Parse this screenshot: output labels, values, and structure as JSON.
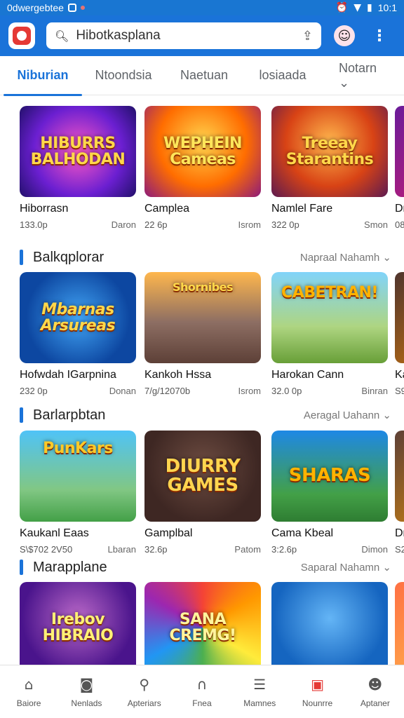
{
  "status": {
    "left_text": "0dwergebtee",
    "time": "10:1"
  },
  "search": {
    "text": "Hibotkasplana"
  },
  "icons": {
    "search": "search-icon",
    "share": "share-icon",
    "avatar": "avatar-icon",
    "menu": "more-vert-icon"
  },
  "tabs": [
    {
      "label": "Niburian",
      "active": true
    },
    {
      "label": "Ntoondsia"
    },
    {
      "label": "Naetuan"
    },
    {
      "label": "losiaada"
    },
    {
      "label": "Notarn ⌄"
    }
  ],
  "sections": [
    {
      "title": "",
      "more": "",
      "items": [
        {
          "title": "Hiborrasn",
          "meta_left": "133.0p",
          "meta_right": "Daron",
          "art": "HIBURRS BALHODAN"
        },
        {
          "title": "Camplea",
          "meta_left": "22 6p",
          "meta_right": "Isrom",
          "art": "WEPHEIN Cameas"
        },
        {
          "title": "Namlel Fare",
          "meta_left": "322 0p",
          "meta_right": "Smon",
          "art": "Treeay Starantins"
        },
        {
          "title": "Dr",
          "meta_left": "08",
          "meta_right": "",
          "art": ""
        }
      ]
    },
    {
      "title": "Balkqplorar",
      "more": "Napraal Nahamh ⌄",
      "items": [
        {
          "title": "Hofwdah IGarpnina",
          "meta_left": "232 0p",
          "meta_right": "Donan",
          "art": "Mbarnas Arsureas"
        },
        {
          "title": "Kankoh Hssa",
          "meta_left": "7/g/12070b",
          "meta_right": "Isrom",
          "art": "Shornibes"
        },
        {
          "title": "Harokan Cann",
          "meta_left": "32.0 0p",
          "meta_right": "Binran",
          "art": "CABETRAN!"
        },
        {
          "title": "Ka",
          "meta_left": "S9",
          "meta_right": "",
          "art": ""
        }
      ]
    },
    {
      "title": "Barlarpbtan",
      "more": "Aeragal Uahann ⌄",
      "items": [
        {
          "title": "Kaukanl Eaas",
          "meta_left": "S\\$702 2V50",
          "meta_right": "Lbaran",
          "art": "PunKars"
        },
        {
          "title": "Gamplbal",
          "meta_left": "32.6p",
          "meta_right": "Patom",
          "art": "DIURRY GAMES"
        },
        {
          "title": "Cama Kbeal",
          "meta_left": "3:2.6p",
          "meta_right": "Dimon",
          "art": "SHARAS"
        },
        {
          "title": "Dr",
          "meta_left": "S2",
          "meta_right": "",
          "art": ""
        }
      ]
    },
    {
      "title": "Marapplane",
      "more": "Saparal Nahamn ⌄",
      "items": [
        {
          "title": "",
          "meta_left": "",
          "meta_right": "",
          "art": "Irebov HIBRAIO"
        },
        {
          "title": "",
          "meta_left": "",
          "meta_right": "",
          "art": "SANA CREMG!"
        },
        {
          "title": "",
          "meta_left": "",
          "meta_right": "",
          "art": ""
        },
        {
          "title": "",
          "meta_left": "",
          "meta_right": "",
          "art": ""
        }
      ]
    }
  ],
  "bottom_nav": [
    {
      "label": "Baiore",
      "icon": "home-icon"
    },
    {
      "label": "Nenlads",
      "icon": "camera-icon"
    },
    {
      "label": "Apteriars",
      "icon": "search-icon"
    },
    {
      "label": "Fnea",
      "icon": "headset-icon"
    },
    {
      "label": "Mamnes",
      "icon": "list-icon"
    },
    {
      "label": "Nounrre",
      "icon": "calendar-icon"
    },
    {
      "label": "Aptaner",
      "icon": "profile-icon"
    }
  ]
}
